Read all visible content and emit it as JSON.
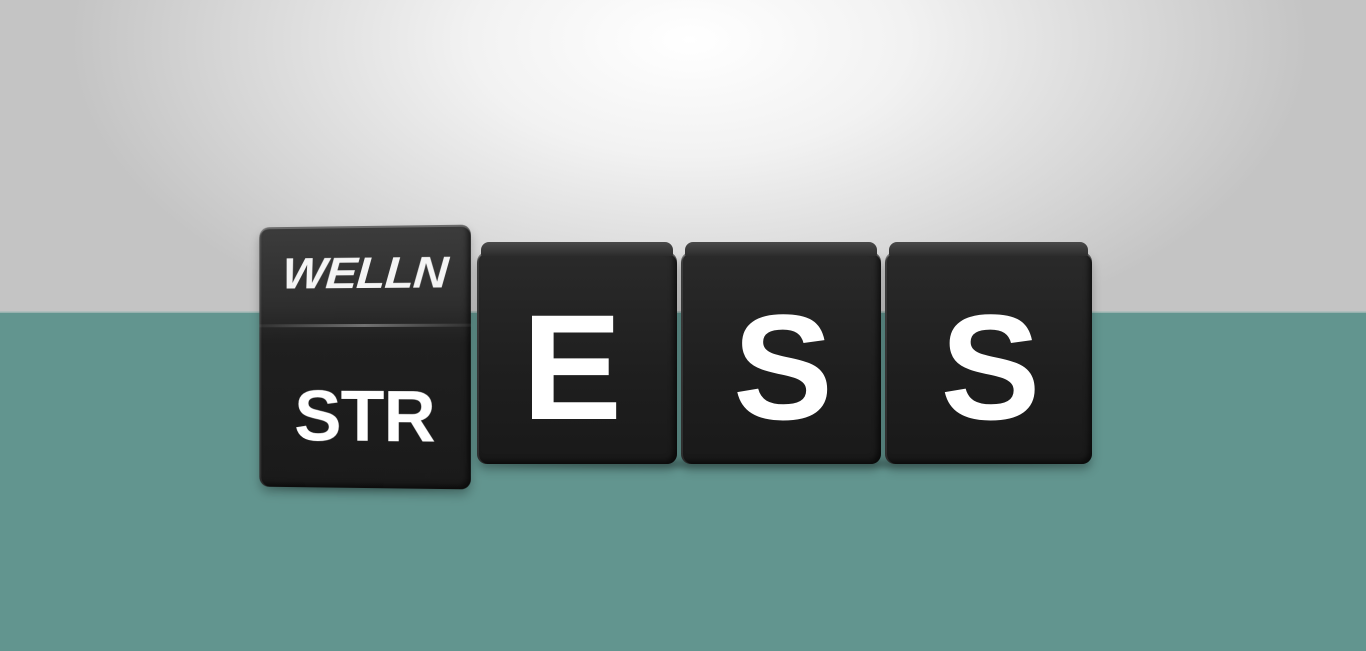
{
  "scene": {
    "background_colors": {
      "wall": "#e8e8e8",
      "table": "#62958f",
      "cube": "#1e1e1e",
      "letters": "#ffffff"
    },
    "flip_cube": {
      "top_text": "WELLN",
      "front_text": "STR"
    },
    "cubes": [
      {
        "letter": "E"
      },
      {
        "letter": "S"
      },
      {
        "letter": "S"
      }
    ]
  }
}
